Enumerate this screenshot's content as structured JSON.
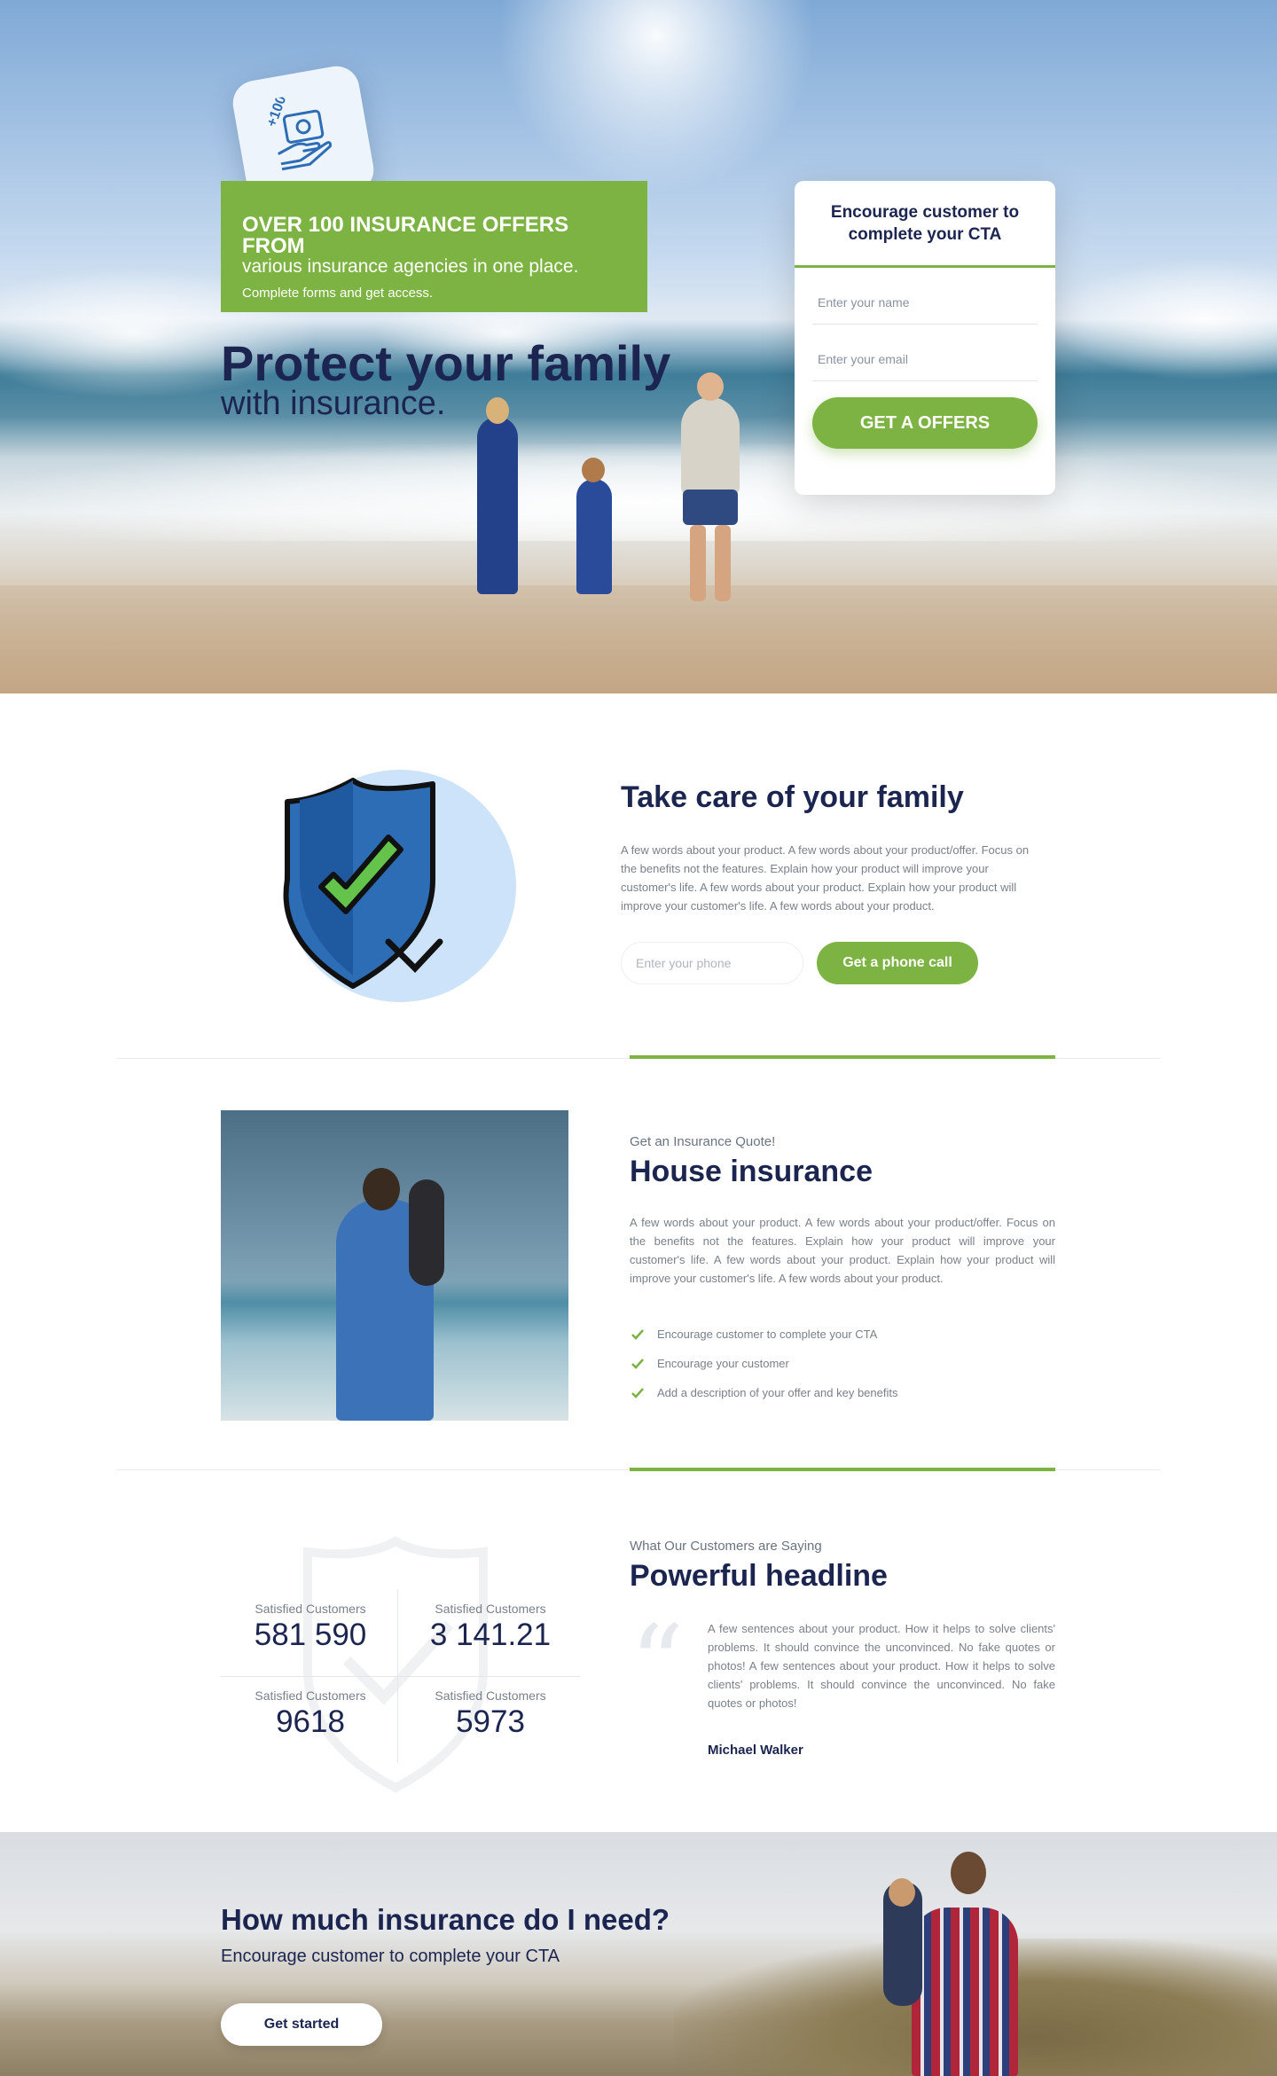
{
  "hero": {
    "offer_title": "OVER 100 INSURANCE OFFERS FROM",
    "offer_subtitle": "various insurance agencies in one place.",
    "offer_note": "Complete forms and get access.",
    "title": "Protect your family",
    "subtitle": "with insurance.",
    "badge_text": "+100"
  },
  "cta_form": {
    "heading": "Encourage customer to complete your CTA",
    "name_placeholder": "Enter your name",
    "email_placeholder": "Enter your email",
    "button_label": "GET A OFFERS"
  },
  "family_section": {
    "title": "Take care of your family",
    "text": "A few words about your product. A few words about your product/offer. Focus on the benefits not the features. Explain how your product will improve your customer's life. A few words about your product. Explain how your product will improve your customer's life. A few words about your product.",
    "phone_placeholder": "Enter your phone",
    "button_label": "Get a phone call"
  },
  "house_section": {
    "kicker": "Get an Insurance Quote!",
    "title": "House insurance",
    "text": "A few words about your product. A few words about your product/offer. Focus on the benefits not the features. Explain how your product will improve your customer's life. A few words about your product. Explain how your product will improve your customer's life. A few words about your product.",
    "benefits": [
      "Encourage customer to complete your CTA",
      "Encourage your customer",
      "Add a description of your offer and key benefits"
    ]
  },
  "stats": [
    {
      "label": "Satisfied Customers",
      "value": "581 590"
    },
    {
      "label": "Satisfied Customers",
      "value": "3 141.21"
    },
    {
      "label": "Satisfied Customers",
      "value": "9618"
    },
    {
      "label": "Satisfied Customers",
      "value": "5973"
    }
  ],
  "testimonial": {
    "kicker": "What Our Customers are Saying",
    "title": "Powerful headline",
    "quote": "A few sentences about your product. How it helps to solve clients' problems. It should convince the unconvinced. No fake quotes or photos! A few sentences about your product. How it helps to solve clients' problems. It should convince the unconvinced. No fake quotes or photos!",
    "author": "Michael Walker"
  },
  "banner": {
    "title": "How much insurance do I need?",
    "subtitle": "Encourage customer to complete your CTA",
    "button_label": "Get started"
  },
  "colors": {
    "accent": "#7cb342",
    "heading": "#1b2550",
    "shield_blue": "#2d6db5",
    "shield_circle": "#cce3fa"
  },
  "icons": {
    "badge": "money-hand-icon",
    "shield": "shield-check-icon",
    "check": "check-icon",
    "quote": "quote-icon"
  }
}
